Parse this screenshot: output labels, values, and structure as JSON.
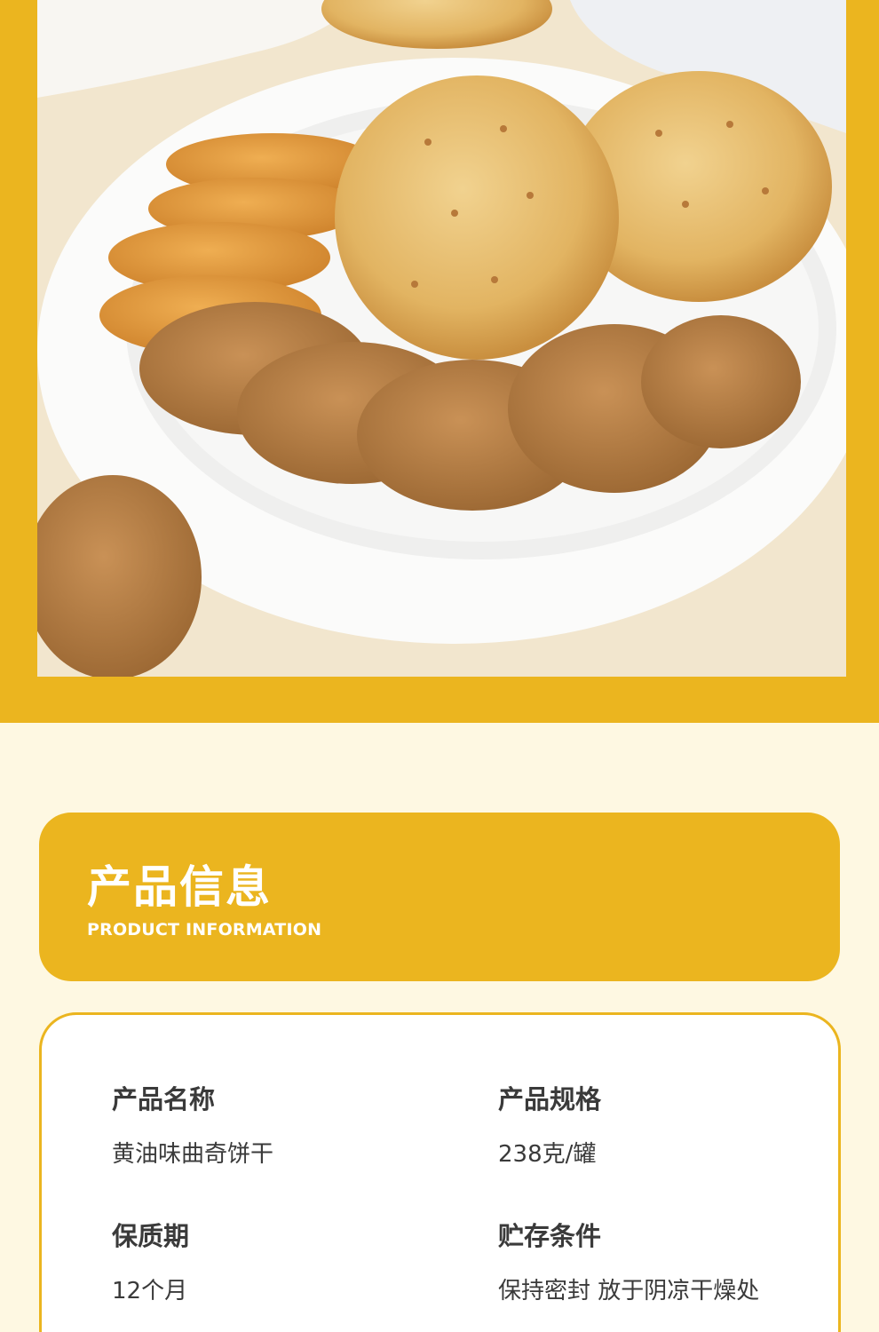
{
  "header": {
    "title": "产品信息",
    "subtitle": "PRODUCT INFORMATION"
  },
  "colors": {
    "accent": "#EBB51F",
    "background": "#FEF8E2",
    "card": "#FFFFFF",
    "text": "#3A3A3A"
  },
  "product_info": [
    {
      "label": "产品名称",
      "value": "黄油味曲奇饼干"
    },
    {
      "label": "产品规格",
      "value": "238克/罐"
    },
    {
      "label": "保质期",
      "value": "12个月"
    },
    {
      "label": "贮存条件",
      "value": "保持密封 放于阴凉干燥处"
    }
  ]
}
